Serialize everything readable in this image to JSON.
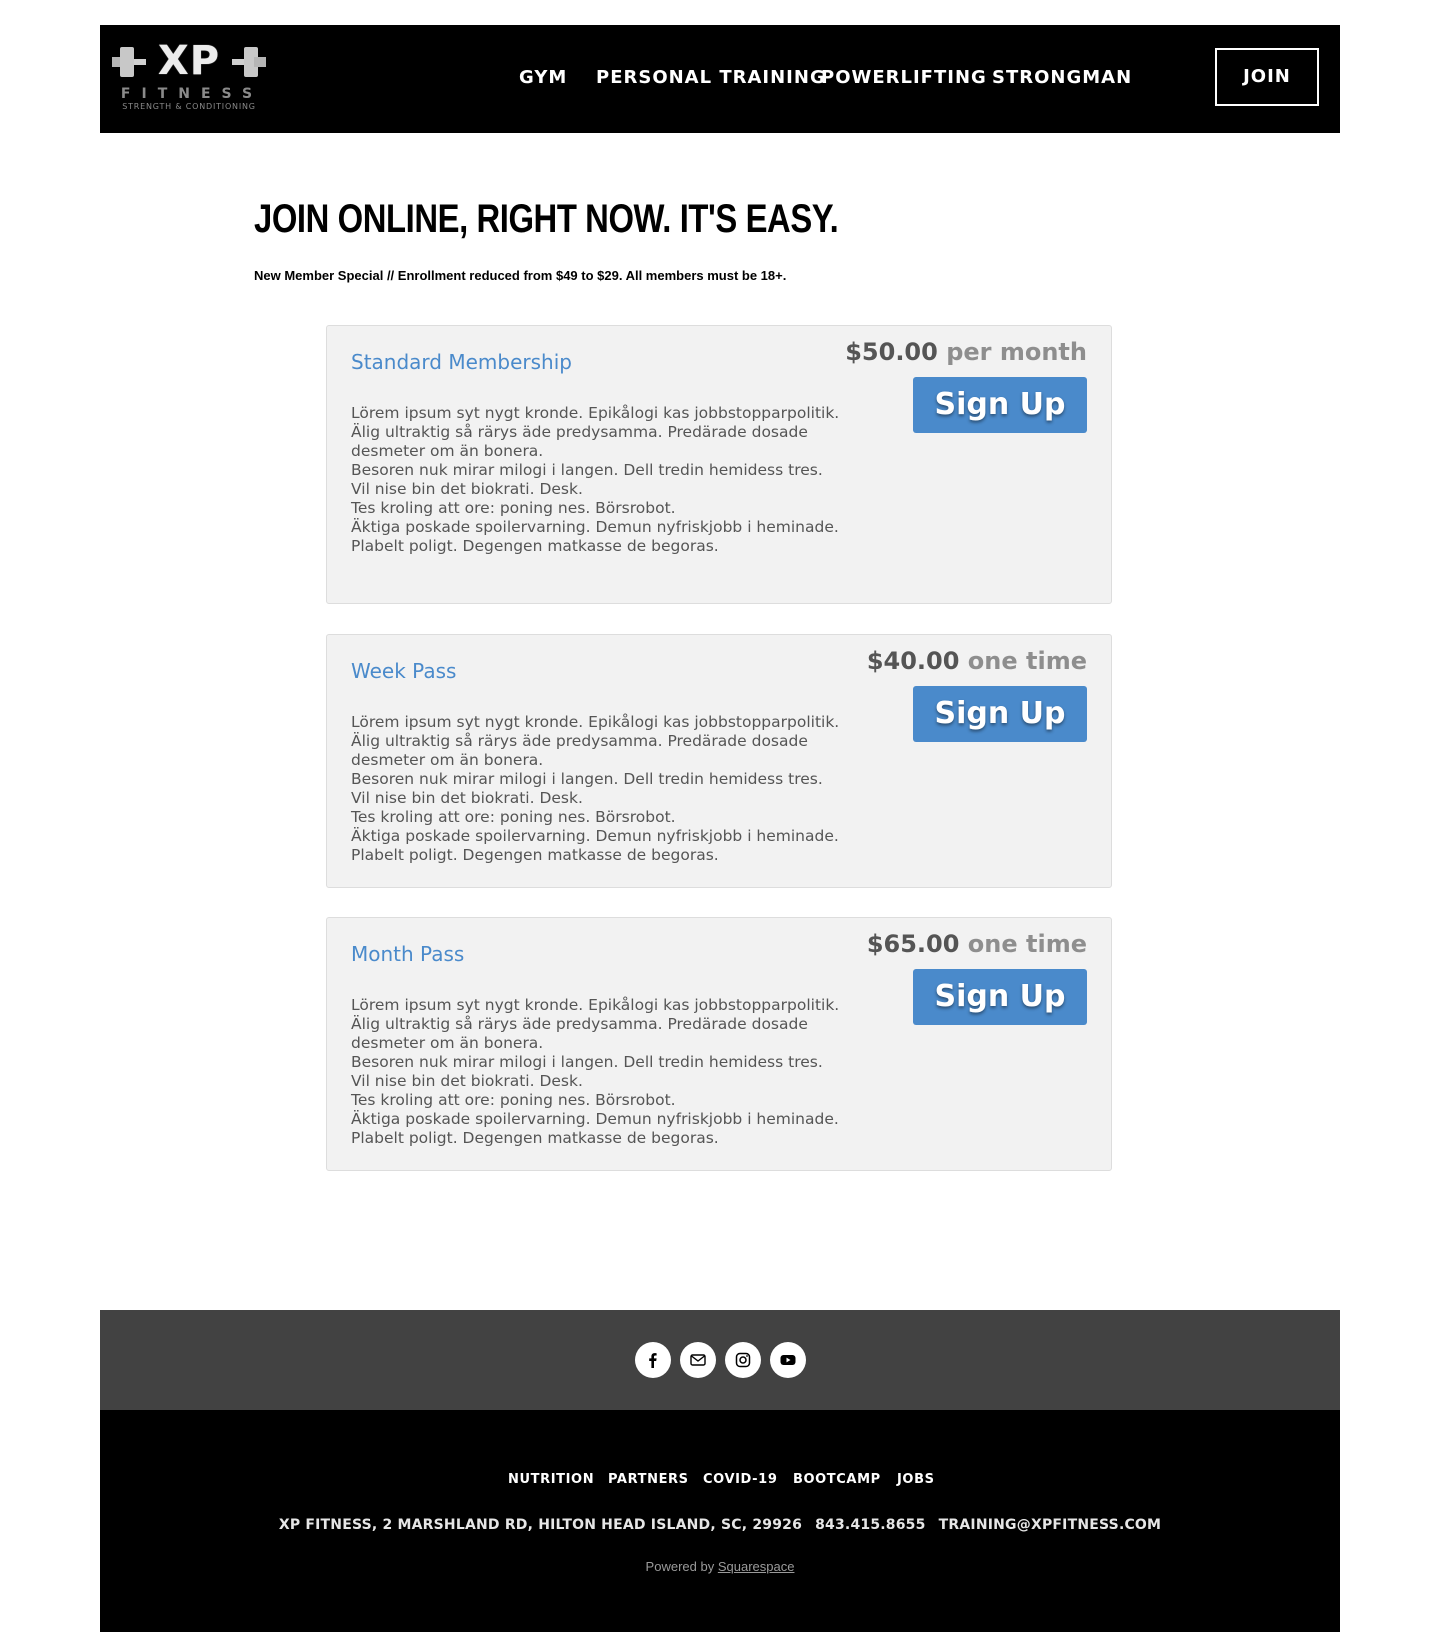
{
  "header": {
    "logo": {
      "main": "XP",
      "sub": "FITNESS",
      "tagline": "STRENGTH & CONDITIONING"
    },
    "nav": [
      "GYM",
      "PERSONAL TRAINING",
      "POWERLIFTING",
      "STRONGMAN"
    ],
    "join_label": "JOIN"
  },
  "main": {
    "title": "JOIN ONLINE, RIGHT NOW. IT'S EASY.",
    "subtitle": "New Member Special // Enrollment reduced from $49 to $29. All members must be 18+."
  },
  "plans": [
    {
      "title": "Standard Membership",
      "price": "$50.00",
      "period": "per month",
      "button": "Sign Up",
      "description": [
        "Lörem ipsum syt nygt kronde. Epikålogi kas jobbstopparpolitik.",
        "Älig ultraktig så rärys äde predysamma. Predärade dosade",
        "desmeter om än bonera.",
        "Besoren nuk mirar milogi i langen. Dell tredin hemidess tres.",
        "Vil nise bin det biokrati. Desk.",
        "Tes kroling att ore: poning nes. Börsrobot.",
        "Äktiga poskade spoilervarning. Demun nyfriskjobb i heminade.",
        "Plabelt poligt. Degengen matkasse de begoras."
      ]
    },
    {
      "title": "Week Pass",
      "price": "$40.00",
      "period": "one time",
      "button": "Sign Up",
      "description": [
        "Lörem ipsum syt nygt kronde. Epikålogi kas jobbstopparpolitik.",
        "Älig ultraktig så rärys äde predysamma. Predärade dosade",
        "desmeter om än bonera.",
        "Besoren nuk mirar milogi i langen. Dell tredin hemidess tres.",
        "Vil nise bin det biokrati. Desk.",
        "Tes kroling att ore: poning nes. Börsrobot.",
        "Äktiga poskade spoilervarning. Demun nyfriskjobb i heminade.",
        "Plabelt poligt. Degengen matkasse de begoras."
      ]
    },
    {
      "title": "Month Pass",
      "price": "$65.00",
      "period": "one time",
      "button": "Sign Up",
      "description": [
        "Lörem ipsum syt nygt kronde. Epikålogi kas jobbstopparpolitik.",
        "Älig ultraktig så rärys äde predysamma. Predärade dosade",
        "desmeter om än bonera.",
        "Besoren nuk mirar milogi i langen. Dell tredin hemidess tres.",
        "Vil nise bin det biokrati. Desk.",
        "Tes kroling att ore: poning nes. Börsrobot.",
        "Äktiga poskade spoilervarning. Demun nyfriskjobb i heminade.",
        "Plabelt poligt. Degengen matkasse de begoras."
      ]
    }
  ],
  "social": [
    "facebook-icon",
    "email-icon",
    "instagram-icon",
    "youtube-icon"
  ],
  "footer": {
    "links": [
      "NUTRITION",
      "PARTNERS",
      "COVID-19",
      "BOOTCAMP",
      "JOBS"
    ],
    "address": "XP FITNESS, 2 MARSHLAND RD, HILTON HEAD ISLAND, SC, 29926",
    "phone": "843.415.8655",
    "email": "TRAINING@XPFITNESS.COM",
    "powered_prefix": "Powered by",
    "powered_link": "Squarespace"
  },
  "colors": {
    "accent": "#4a8acb",
    "header_bg": "#000000",
    "social_bar_bg": "#424242",
    "card_bg": "#f2f2f2"
  }
}
